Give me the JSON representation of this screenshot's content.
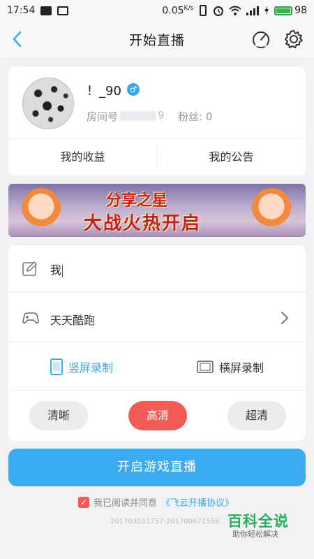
{
  "status_bar": {
    "time": "17:54",
    "speed": "0.05",
    "speed_unit": "K/s",
    "battery": "98",
    "battery_level": 0.98
  },
  "header": {
    "title": "开始直播",
    "back_icon": "chevron-left-icon",
    "stats_icon": "gauge-icon",
    "settings_icon": "gear-icon"
  },
  "profile": {
    "username": "！_90",
    "gender_icon": "male-icon",
    "gender_symbol": "♂",
    "room_label": "房间号",
    "room_suffix": "9",
    "fans": "粉丝: 0",
    "earnings_label": "我的收益",
    "notice_label": "我的公告"
  },
  "banner": {
    "line1": "分享之星",
    "line2": "大战火热开启"
  },
  "form": {
    "title_value": "我",
    "game_name": "天天酷跑",
    "portrait_label": "竖屏录制",
    "landscape_label": "横屏录制",
    "quality_options": [
      "清晰",
      "高清",
      "超清"
    ],
    "selected_quality": "高清"
  },
  "actions": {
    "start_label": "开启游戏直播",
    "agree_text": "我已阅读并同意",
    "agree_link": "《飞云开播协议》",
    "version": "201703031757-201700671556"
  },
  "watermark": {
    "main": "百科全说",
    "sub": "助你轻松解决"
  },
  "colors": {
    "accent_blue": "#3aabf0",
    "accent_red": "#f25b53",
    "background": "#f2f2f4"
  }
}
